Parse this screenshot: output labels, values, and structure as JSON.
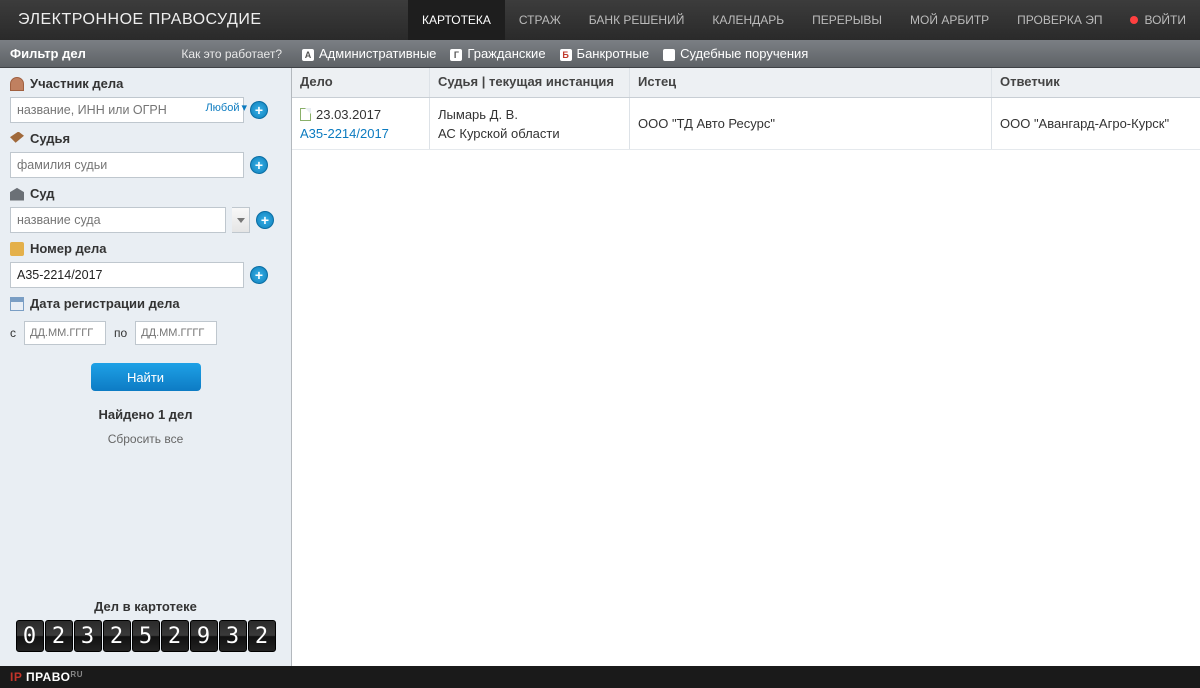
{
  "header": {
    "logo": "ЭЛЕКТРОННОЕ ПРАВОСУДИЕ",
    "nav": [
      "КАРТОТЕКА",
      "СТРАЖ",
      "БАНК РЕШЕНИЙ",
      "КАЛЕНДАРЬ",
      "ПЕРЕРЫВЫ",
      "МОЙ АРБИТР",
      "ПРОВЕРКА ЭП"
    ],
    "login": "ВОЙТИ"
  },
  "secbar": {
    "filter_title": "Фильтр дел",
    "how": "Как это работает?",
    "types": [
      "Административные",
      "Гражданские",
      "Банкротные",
      "Судебные поручения"
    ]
  },
  "filters": {
    "participant": {
      "title": "Участник дела",
      "placeholder": "название, ИНН или ОГРН",
      "type_label": "Любой"
    },
    "judge": {
      "title": "Судья",
      "placeholder": "фамилия судьи"
    },
    "court": {
      "title": "Суд",
      "placeholder": "название суда"
    },
    "case": {
      "title": "Номер дела",
      "value": "А35-2214/2017"
    },
    "date": {
      "title": "Дата регистрации дела",
      "from_lbl": "с",
      "to_lbl": "по",
      "placeholder": "ДД.ММ.ГГГГ"
    },
    "find": "Найти",
    "found": "Найдено 1 дел",
    "reset": "Сбросить все"
  },
  "counter": {
    "label": "Дел в картотеке",
    "digits": [
      "0",
      "2",
      "3",
      "2",
      "5",
      "2",
      "9",
      "3",
      "2"
    ]
  },
  "table": {
    "headers": [
      "Дело",
      "Судья | текущая инстанция",
      "Истец",
      "Ответчик"
    ],
    "row": {
      "date": "23.03.2017",
      "case_no": "А35-2214/2017",
      "judge": "Лымарь Д. В.",
      "court": "АС Курской области",
      "plaintiff": "ООО \"ТД Авто Ресурс\"",
      "defendant": "ООО \"Авангард-Агро-Курск\""
    }
  },
  "footer": {
    "brand": "ПРАВО",
    "suffix": "RU"
  }
}
